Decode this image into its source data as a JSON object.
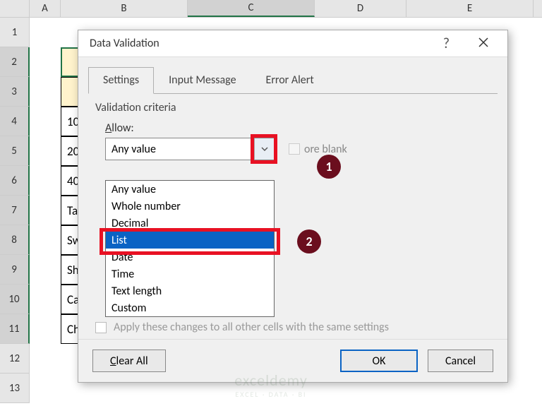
{
  "columns": [
    "A",
    "B",
    "C",
    "D",
    "E"
  ],
  "rows": [
    "1",
    "2",
    "3",
    "4",
    "5",
    "6",
    "7",
    "8",
    "9",
    "10",
    "11",
    "12",
    "13"
  ],
  "col_B_cells": [
    "",
    "",
    "",
    "10",
    "20",
    "40",
    "Ta",
    "Sw",
    "Sh",
    "Ca",
    "Ch"
  ],
  "dialog": {
    "title": "Data Validation",
    "help": "?",
    "tabs": {
      "settings": "Settings",
      "input_message": "Input Message",
      "error_alert": "Error Alert"
    },
    "criteria_label": "Validation criteria",
    "allow_label_pre": "A",
    "allow_label_rest": "llow:",
    "allow_value": "Any value",
    "ignore_blank": "ore blank",
    "options": [
      "Any value",
      "Whole number",
      "Decimal",
      "List",
      "Date",
      "Time",
      "Text length",
      "Custom"
    ],
    "apply_text": "Apply these changes to all other cells with the same settings",
    "clear_all_pre": "C",
    "clear_all_rest": "lear All",
    "ok": "OK",
    "cancel": "Cancel"
  },
  "badges": {
    "one": "1",
    "two": "2"
  },
  "watermark": {
    "main": "exceldemy",
    "sub": "EXCEL · DATA · BI"
  }
}
